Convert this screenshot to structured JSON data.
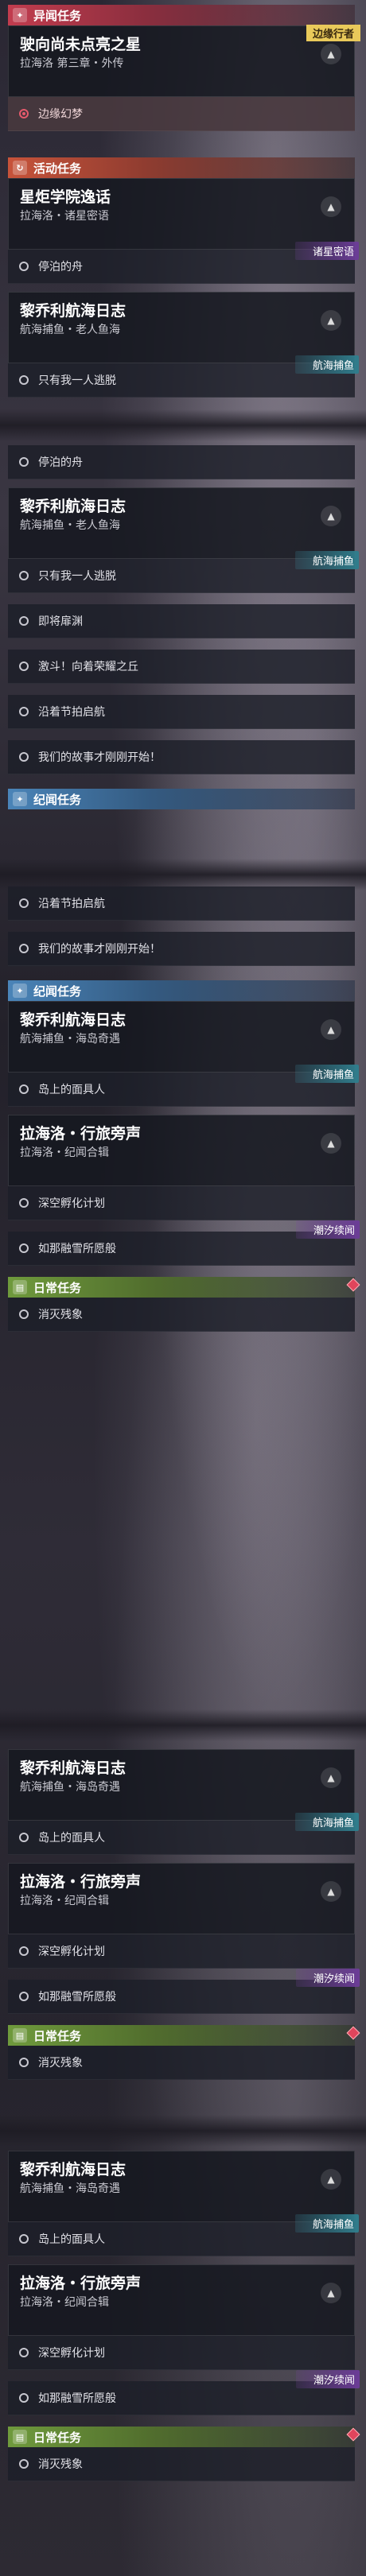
{
  "sections": {
    "yiwen": "异闻任务",
    "huodong": "活动任务",
    "jiwen": "纪闻任务",
    "richang": "日常任务"
  },
  "cards": {
    "liuxing": {
      "title": "驶向尚未点亮之星",
      "sub": "拉海洛 第三章・外传",
      "tag": "边缘行者"
    },
    "xingju": {
      "title": "星炬学院逸话",
      "sub": "拉海洛・诸星密语",
      "tag": "诸星密语"
    },
    "liqiao1": {
      "title": "黎乔利航海日志",
      "sub": "航海捕鱼・老人鱼海",
      "tag": "航海捕鱼"
    },
    "liqiao2": {
      "title": "黎乔利航海日志",
      "sub": "航海捕鱼・海岛奇遇",
      "tag": "航海捕鱼"
    },
    "lahai": {
      "title": "拉海洛・行旅旁声",
      "sub": "拉海洛・纪闻合辑",
      "tag": "潮汐续闻"
    }
  },
  "items": {
    "bianyuan": "边缘幻梦",
    "tingbo": "停泊的舟",
    "zhiyou": "只有我一人逃脱",
    "jijiang": "即将扉渊",
    "jiaodou": "激斗！向着荣耀之丘",
    "yanzhe": "沿着节拍启航",
    "gushi": "我们的故事才刚刚开始！",
    "daoshang": "岛上的面具人",
    "shenkong": "深空孵化计划",
    "runa": "如那融雪所愿般",
    "xiaomie": "消灭残象"
  }
}
